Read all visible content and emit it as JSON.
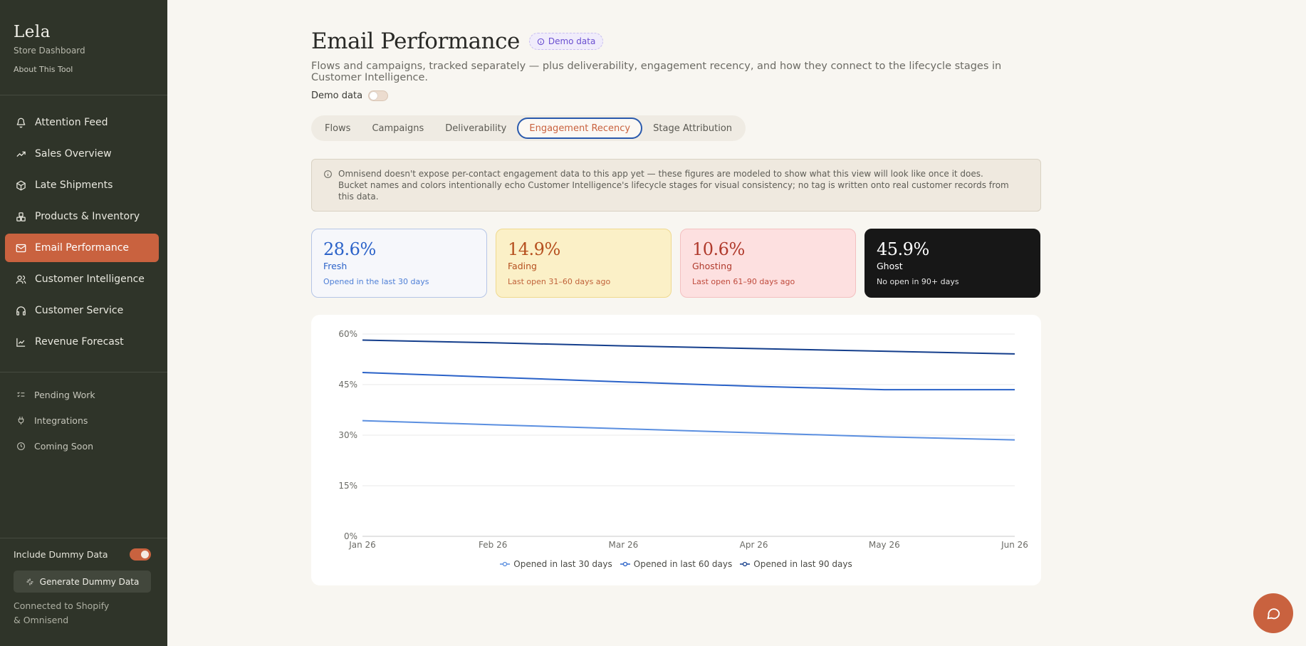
{
  "sidebar": {
    "brand": "Lela",
    "subtitle": "Store Dashboard",
    "about": "About This Tool",
    "items": [
      {
        "label": "Attention Feed",
        "icon": "bell-icon"
      },
      {
        "label": "Sales Overview",
        "icon": "trending-up-icon"
      },
      {
        "label": "Late Shipments",
        "icon": "package-icon"
      },
      {
        "label": "Products & Inventory",
        "icon": "boxes-icon"
      },
      {
        "label": "Email Performance",
        "icon": "mail-icon",
        "active": true
      },
      {
        "label": "Customer Intelligence",
        "icon": "users-icon"
      },
      {
        "label": "Customer Service",
        "icon": "headphones-icon"
      },
      {
        "label": "Revenue Forecast",
        "icon": "line-chart-icon"
      }
    ],
    "secondary": [
      {
        "label": "Pending Work",
        "icon": "list-checks-icon"
      },
      {
        "label": "Integrations",
        "icon": "plug-icon"
      },
      {
        "label": "Coming Soon",
        "icon": "clock-icon"
      }
    ],
    "include_dummy_label": "Include Dummy Data",
    "include_dummy_on": true,
    "generate_label": "Generate Dummy Data",
    "connected_line1": "Connected to Shopify",
    "connected_line2": "& Omnisend"
  },
  "header": {
    "title": "Email Performance",
    "badge": "Demo data",
    "subtitle": "Flows and campaigns, tracked separately — plus deliverability, engagement recency, and how they connect to the lifecycle stages in Customer Intelligence.",
    "demo_toggle_label": "Demo data",
    "demo_toggle_on": false
  },
  "tabs": [
    {
      "label": "Flows"
    },
    {
      "label": "Campaigns"
    },
    {
      "label": "Deliverability"
    },
    {
      "label": "Engagement Recency",
      "active": true
    },
    {
      "label": "Stage Attribution"
    }
  ],
  "notice": "Omnisend doesn't expose per-contact engagement data to this app yet — these figures are modeled to show what this view will look like once it does. Bucket names and colors intentionally echo Customer Intelligence's lifecycle stages for visual consistency; no tag is written onto real customer records from this data.",
  "cards": [
    {
      "value": "28.6%",
      "label": "Fresh",
      "desc": "Opened in the last 30 days"
    },
    {
      "value": "14.9%",
      "label": "Fading",
      "desc": "Last open 31–60 days ago"
    },
    {
      "value": "10.6%",
      "label": "Ghosting",
      "desc": "Last open 61–90 days ago"
    },
    {
      "value": "45.9%",
      "label": "Ghost",
      "desc": "No open in 90+ days"
    }
  ],
  "colors": {
    "accent": "#c9623f",
    "series_30": "#5b8fe0",
    "series_60": "#2a62c8",
    "series_90": "#143e8c"
  },
  "chart_data": {
    "type": "line",
    "x": [
      "Jan 26",
      "Feb 26",
      "Mar 26",
      "Apr 26",
      "May 26",
      "Jun 26"
    ],
    "y_ticks": [
      "0%",
      "15%",
      "30%",
      "45%",
      "60%"
    ],
    "ylim": [
      0,
      60
    ],
    "grid": true,
    "legend_position": "bottom",
    "series": [
      {
        "name": "Opened in last 30 days",
        "values": [
          34.3,
          33.1,
          31.9,
          30.7,
          29.5,
          28.6
        ]
      },
      {
        "name": "Opened in last 60 days",
        "values": [
          48.6,
          47.2,
          45.8,
          44.5,
          43.5,
          43.5
        ]
      },
      {
        "name": "Opened in last 90 days",
        "values": [
          58.2,
          57.4,
          56.5,
          55.7,
          54.9,
          54.1
        ]
      }
    ]
  },
  "chat": {
    "icon": "chat-bubble-icon"
  }
}
